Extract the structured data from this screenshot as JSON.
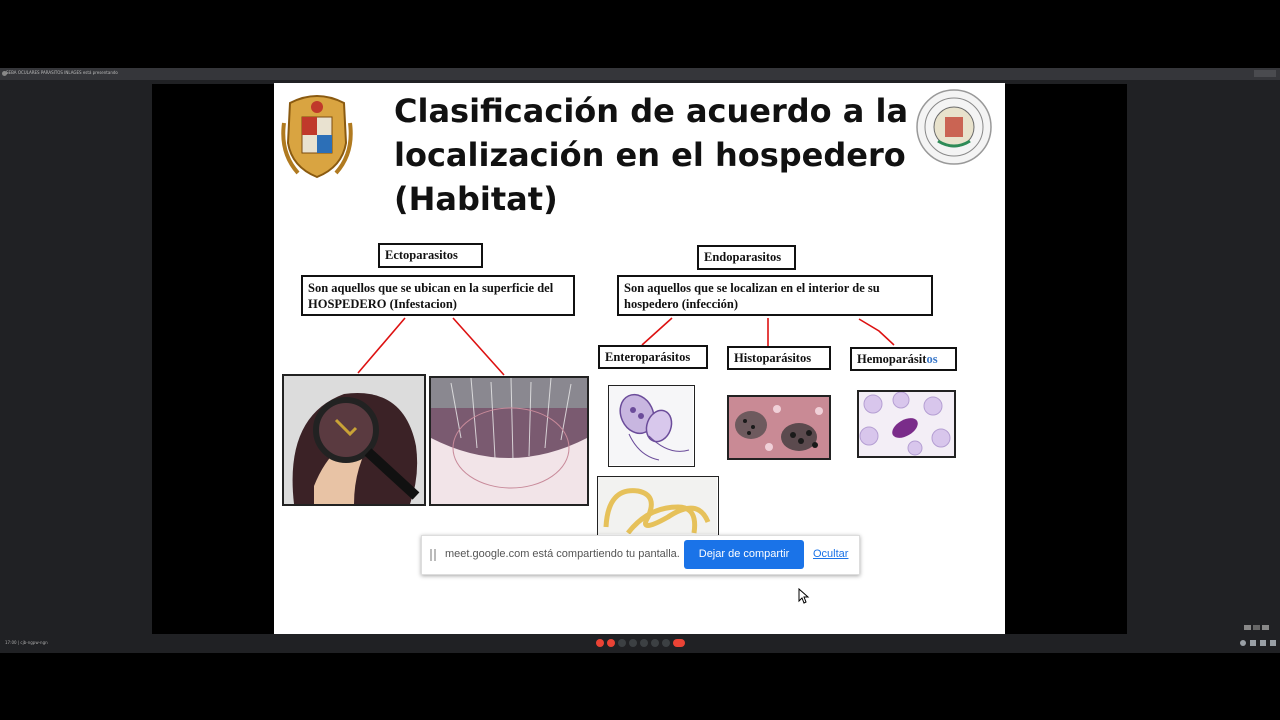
{
  "tab": {
    "title": "SEBA OCULARES PARASITOS INLAGES está presentando"
  },
  "slide": {
    "title_lines": [
      "Clasificación de acuerdo a la",
      "localización en el hospedero",
      "(Habitat)"
    ],
    "ecto": {
      "label": "Ectoparasitos",
      "description": "Son aquellos que se ubican en la superficie del HOSPEDERO  (Infestacion)"
    },
    "endo": {
      "label": "Endoparasitos",
      "description": "Son aquellos que se localizan en el interior de su hospedero (infección)",
      "types": [
        {
          "label": "Enteroparásitos"
        },
        {
          "label": "Histoparásitos"
        },
        {
          "label_main": "Hemoparásit",
          "label_tail": "os"
        }
      ]
    }
  },
  "share_bar": {
    "text": "meet.google.com está compartiendo tu pantalla.",
    "stop_button": "Dejar de compartir",
    "hide_link": "Ocultar"
  },
  "meet_bar": {
    "time_label": "17:00  |  cjb-ngpw-ngn"
  },
  "colors": {
    "accent": "#1a73e8",
    "line_red": "#d11111",
    "end_call": "#ea4335"
  }
}
